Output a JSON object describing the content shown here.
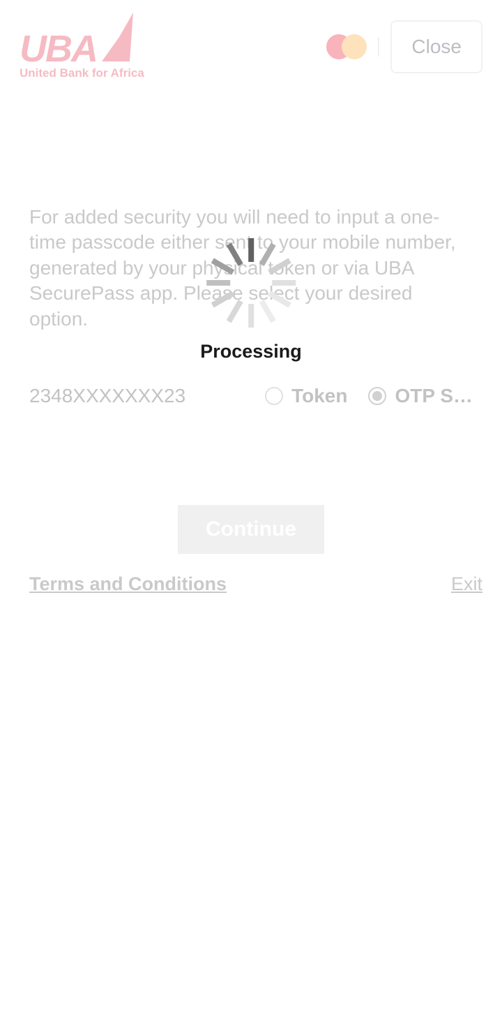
{
  "header": {
    "logo_text": "UBA",
    "logo_tagline": "United Bank for Africa",
    "close_label": "Close"
  },
  "content": {
    "description": "For added security you will need to input a one-time passcode either sent to your mobile number, generated by your physical token or via UBA SecurePass app. Please select your desired option.",
    "phone_number": "2348XXXXXXX23"
  },
  "options": {
    "token_label": "Token",
    "otp_label": "OTP S…"
  },
  "buttons": {
    "continue_label": "Continue"
  },
  "footer": {
    "terms_label": "Terms and Conditions",
    "exit_label": "Exit"
  },
  "overlay": {
    "processing_label": "Processing"
  }
}
